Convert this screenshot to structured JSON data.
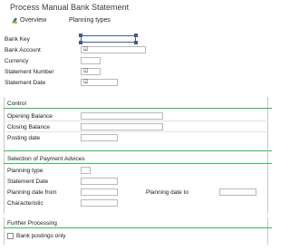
{
  "window": {
    "title": "Process Manual Bank Statement"
  },
  "toolbar": {
    "overview_label": "Overview",
    "planning_types_label": "Planning types"
  },
  "header_fields": {
    "bank_key": {
      "label": "Bank Key",
      "value": ""
    },
    "bank_account": {
      "label": "Bank Account",
      "value": ""
    },
    "currency": {
      "label": "Currency",
      "value": ""
    },
    "statement_number": {
      "label": "Statement Number",
      "value": ""
    },
    "statement_date": {
      "label": "Statement Date",
      "value": ""
    }
  },
  "control": {
    "title": "Control",
    "opening_balance": {
      "label": "Opening Balance",
      "value": ""
    },
    "closing_balance": {
      "label": "Closing Balance",
      "value": ""
    },
    "posting_date": {
      "label": "Posting date",
      "value": ""
    }
  },
  "payment_advices": {
    "title": "Selection of Payment Advices",
    "planning_type": {
      "label": "Planning type",
      "value": ""
    },
    "statement_date": {
      "label": "Statement Date",
      "value": ""
    },
    "planning_date_from": {
      "label": "Planning date from",
      "value": ""
    },
    "planning_date_to": {
      "label": "Planning date to",
      "value": ""
    },
    "characteristic": {
      "label": "Characteristic",
      "value": ""
    }
  },
  "further_processing": {
    "title": "Further Processing",
    "bank_postings_only": {
      "label": "Bank postings only",
      "checked": false
    }
  },
  "colors": {
    "accent_line": "#2ec24a",
    "selection_border": "#3a5fa7"
  }
}
